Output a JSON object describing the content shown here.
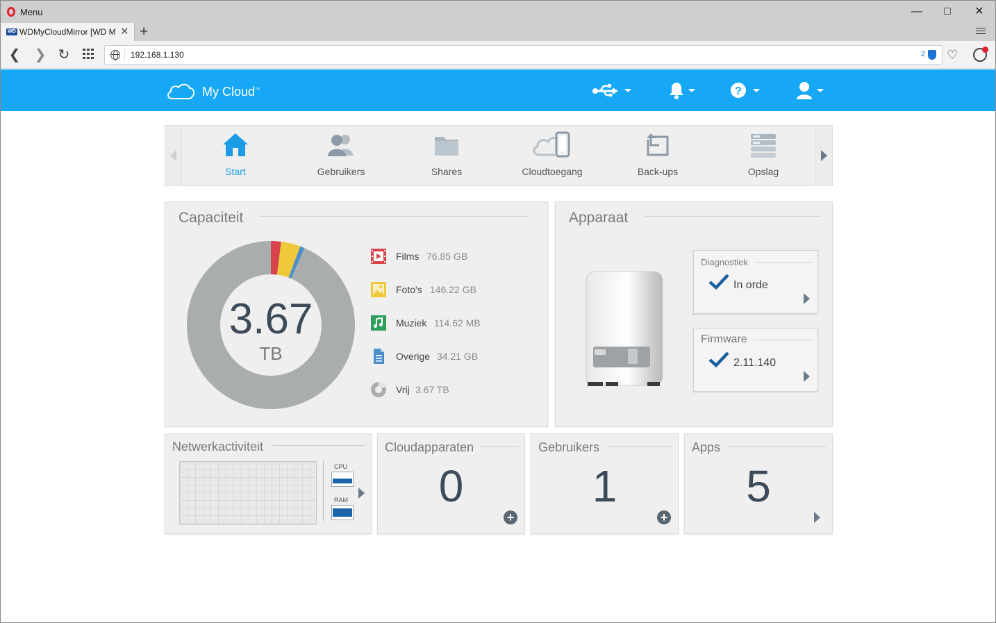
{
  "browser": {
    "menu_label": "Menu",
    "tab_title": "WDMyCloudMirror [WD M",
    "tab_favicon_text": "WD",
    "url": "192.168.1.130",
    "tracker_count": "2"
  },
  "header": {
    "brand": "My Cloud",
    "brand_mark": "™",
    "icons": [
      "usb-icon",
      "bell-icon",
      "help-icon",
      "user-icon"
    ]
  },
  "nav": {
    "items": [
      {
        "label": "Start",
        "icon": "home-icon",
        "active": true
      },
      {
        "label": "Gebruikers",
        "icon": "users-icon"
      },
      {
        "label": "Shares",
        "icon": "folder-icon"
      },
      {
        "label": "Cloudtoegang",
        "icon": "cloud-access-icon"
      },
      {
        "label": "Back-ups",
        "icon": "backup-icon"
      },
      {
        "label": "Opslag",
        "icon": "storage-icon"
      }
    ]
  },
  "capacity": {
    "title": "Capaciteit",
    "total_value": "3.67",
    "total_unit": "TB",
    "legend": [
      {
        "name": "Films",
        "value": "76.85 GB",
        "color": "#d9434c",
        "icon": "film-icon"
      },
      {
        "name": "Foto's",
        "value": "146.22 GB",
        "color": "#f0c93a",
        "icon": "photo-icon"
      },
      {
        "name": "Muziek",
        "value": "114.62 MB",
        "color": "#2e9e5b",
        "icon": "music-icon"
      },
      {
        "name": "Overige",
        "value": "34.21 GB",
        "color": "#4a8fc9",
        "icon": "document-icon"
      },
      {
        "name": "Vrij",
        "value": "3.67 TB",
        "color": "#a9adad",
        "icon": "pie-icon"
      }
    ]
  },
  "device": {
    "title": "Apparaat",
    "diagnostics": {
      "title": "Diagnostiek",
      "value": "In orde"
    },
    "firmware": {
      "title": "Firmware",
      "value": "2.11.140"
    }
  },
  "network": {
    "title": "Netwerkactiviteit",
    "cpu_label": "CPU",
    "ram_label": "RAM"
  },
  "cloud_devices": {
    "title": "Cloudapparaten",
    "count": "0"
  },
  "users": {
    "title": "Gebruikers",
    "count": "1"
  },
  "apps": {
    "title": "Apps",
    "count": "5"
  }
}
